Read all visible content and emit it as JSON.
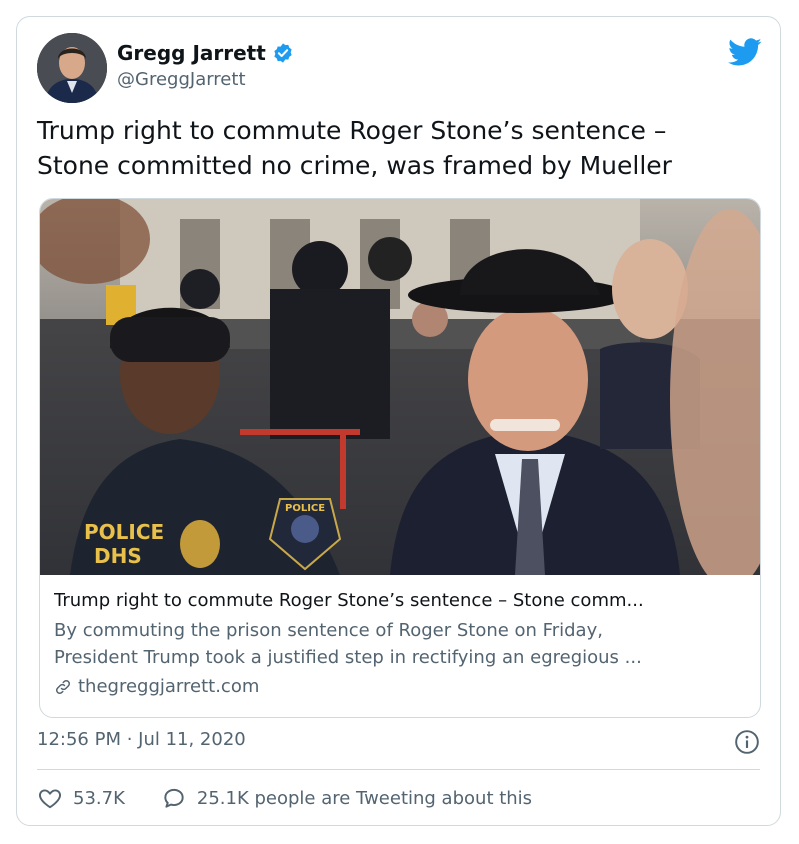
{
  "author": {
    "name": "Gregg Jarrett",
    "handle": "@GreggJarrett",
    "verified": true
  },
  "tweet": {
    "text_line1": "Trump right to commute Roger Stone’s sentence –",
    "text_line2": "Stone committed no crime, was framed by Mueller"
  },
  "link_card": {
    "title": "Trump right to commute Roger Stone’s sentence – Stone comm...",
    "description_line1": "By commuting the prison sentence of Roger Stone on Friday,",
    "description_line2": "President Trump took a justified step in rectifying an egregious ...",
    "domain": "thegreggjarrett.com",
    "image_badge_1": "POLICE",
    "image_badge_2": "DHS",
    "image_badge_3": "POLICE"
  },
  "meta": {
    "timestamp": "12:56 PM · Jul 11, 2020"
  },
  "actions": {
    "likes": "53.7K",
    "tweeting": "25.1K people are Tweeting about this"
  },
  "colors": {
    "brand": "#1d9bf0",
    "secondary_text": "#536471",
    "border": "#cfd9de"
  },
  "icons": [
    "twitter-bird-icon",
    "verified-badge-icon",
    "link-icon",
    "info-icon",
    "heart-icon",
    "reply-bubble-icon"
  ]
}
